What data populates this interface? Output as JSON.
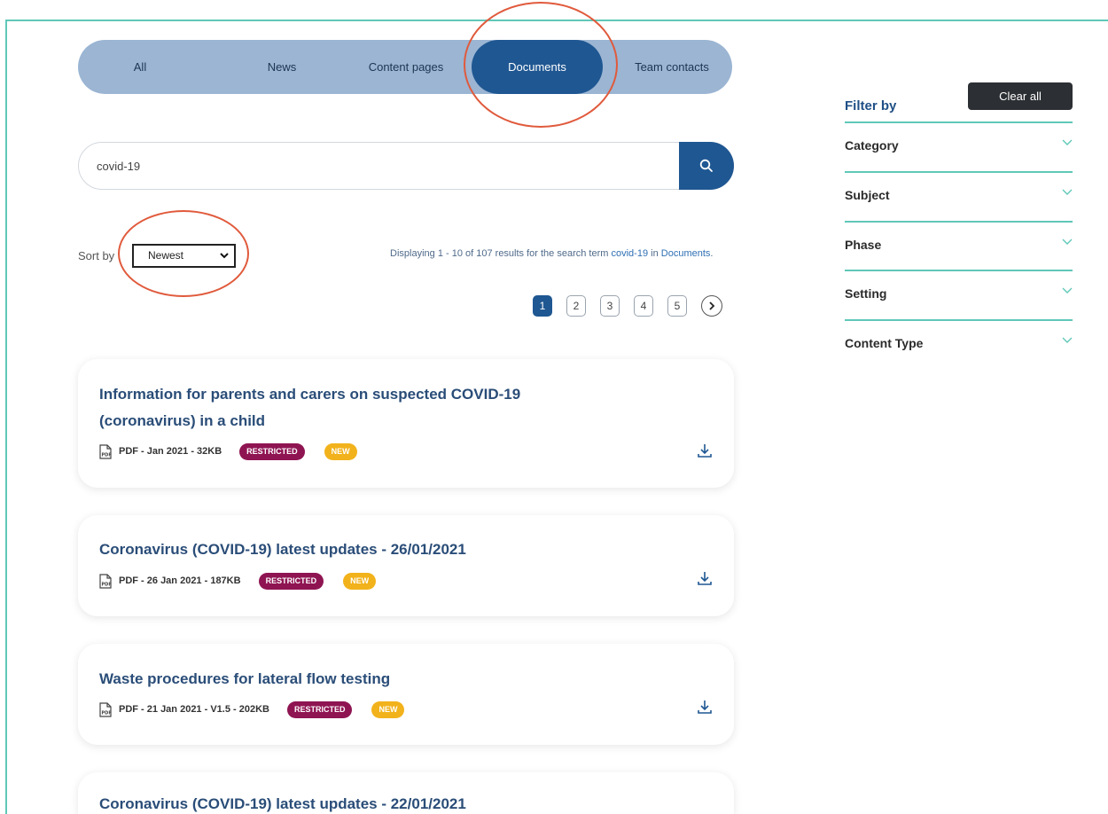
{
  "tabs": [
    {
      "label": "All",
      "active": false
    },
    {
      "label": "News",
      "active": false
    },
    {
      "label": "Content pages",
      "active": false
    },
    {
      "label": "Documents",
      "active": true
    },
    {
      "label": "Team contacts",
      "active": false
    }
  ],
  "search": {
    "value": "covid-19",
    "icon": "search-icon"
  },
  "sort": {
    "label": "Sort by",
    "selected": "Newest"
  },
  "results": {
    "prefix": "Displaying",
    "range": "1 - 10",
    "of_text": "of 107 results for the search term",
    "term": "covid-19",
    "in_text": "in",
    "section": "Documents",
    "suffix": "."
  },
  "pagination": {
    "pages": [
      "1",
      "2",
      "3",
      "4",
      "5"
    ],
    "current": "1",
    "next_icon": "chevron-right-icon"
  },
  "documents": [
    {
      "title_line1": "Information for parents and carers on suspected COVID-19",
      "title_line2": "(coronavirus) in a child",
      "meta": "PDF - Jan 2021 - 32KB",
      "badges": [
        "RESTRICTED",
        "NEW"
      ]
    },
    {
      "title_line1": "Coronavirus (COVID-19) latest updates - 26/01/2021",
      "meta": "PDF - 26 Jan 2021 - 187KB",
      "badges": [
        "RESTRICTED",
        "NEW"
      ]
    },
    {
      "title_line1": "Waste procedures for lateral flow testing",
      "meta": "PDF - 21 Jan 2021 - V1.5 - 202KB",
      "badges": [
        "RESTRICTED",
        "NEW"
      ]
    },
    {
      "title_line1": "Coronavirus (COVID-19) latest updates - 22/01/2021"
    }
  ],
  "filter": {
    "title": "Filter by",
    "clear_label": "Clear all",
    "items": [
      "Category",
      "Subject",
      "Phase",
      "Setting",
      "Content Type"
    ]
  },
  "colors": {
    "accent": "#1f5792",
    "tab_bar": "#9bb5d3",
    "teal_rule": "#5fc8b8",
    "restricted": "#8f1452",
    "new": "#f2b21b",
    "annotation": "#e05a3c"
  }
}
